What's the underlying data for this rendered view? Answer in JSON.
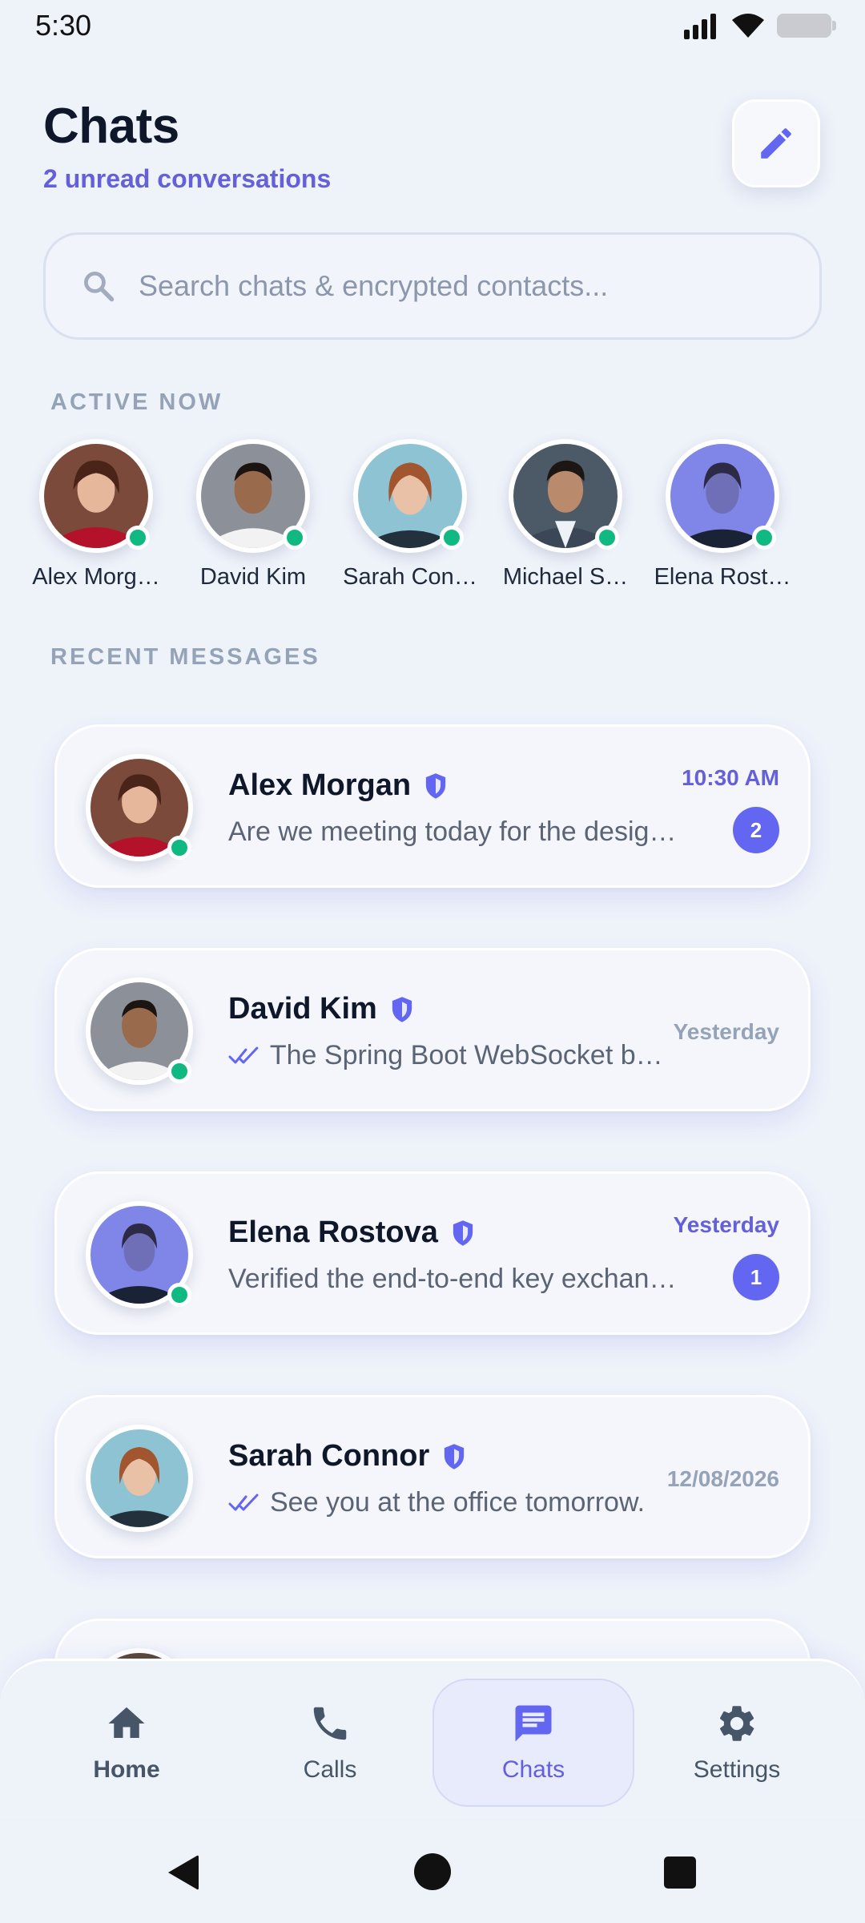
{
  "status_bar": {
    "time": "5:30"
  },
  "header": {
    "title": "Chats",
    "subtitle": "2 unread conversations"
  },
  "search": {
    "placeholder": "Search chats & encrypted contacts..."
  },
  "sections": {
    "active_now": "ACTIVE NOW",
    "recent_messages": "RECENT MESSAGES"
  },
  "active_contacts": [
    {
      "name": "Alex Morg…",
      "online": true,
      "avatar": "avatar-alex"
    },
    {
      "name": "David Kim",
      "online": true,
      "avatar": "avatar-david"
    },
    {
      "name": "Sarah Con…",
      "online": true,
      "avatar": "avatar-sarah"
    },
    {
      "name": "Michael S…",
      "online": true,
      "avatar": "avatar-michael"
    },
    {
      "name": "Elena Rost…",
      "online": true,
      "avatar": "avatar-elena"
    }
  ],
  "messages": [
    {
      "name": "Alex Morgan",
      "preview": "Are we meeting today for the desig…",
      "time": "10:30 AM",
      "unread": "2",
      "read_receipt": false,
      "online": true,
      "verified": true
    },
    {
      "name": "David Kim",
      "preview": "The Spring Boot WebSocket ba…",
      "time": "Yesterday",
      "unread": null,
      "read_receipt": true,
      "online": true,
      "verified": true
    },
    {
      "name": "Elena Rostova",
      "preview": "Verified the end-to-end key exchan…",
      "time": "Yesterday",
      "unread": "1",
      "read_receipt": false,
      "online": true,
      "verified": true
    },
    {
      "name": "Sarah Connor",
      "preview": "See you at the office tomorrow.",
      "time": "12/08/2026",
      "unread": null,
      "read_receipt": true,
      "online": false,
      "verified": true
    }
  ],
  "bottom_nav": [
    {
      "label": "Home",
      "icon": "home-icon"
    },
    {
      "label": "Calls",
      "icon": "phone-icon"
    },
    {
      "label": "Chats",
      "icon": "chat-icon",
      "active": true
    },
    {
      "label": "Settings",
      "icon": "gear-icon"
    }
  ],
  "colors": {
    "accent": "#6366f1",
    "accent_text": "#6360d9",
    "online": "#10b981",
    "background": "#eef2f9"
  }
}
